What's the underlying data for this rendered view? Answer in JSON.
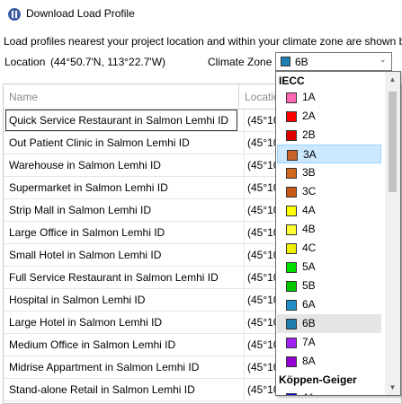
{
  "window": {
    "title": "Download Load Profile"
  },
  "description": "Load profiles nearest your project location and within your climate zone are shown b",
  "location": {
    "label": "Location",
    "value": "(44°50.7'N, 113°22.7'W)"
  },
  "climate_zone": {
    "label": "Climate Zone",
    "selected": "6B",
    "selected_color": "#1e7fb0"
  },
  "table": {
    "columns": [
      "Name",
      "Location",
      ""
    ],
    "rows": [
      {
        "name": "Quick Service Restaurant in Salmon Lemhi ID",
        "loc": "(45°10"
      },
      {
        "name": "Out Patient Clinic in Salmon Lemhi ID",
        "loc": "(45°10"
      },
      {
        "name": "Warehouse in Salmon Lemhi ID",
        "loc": "(45°10"
      },
      {
        "name": "Supermarket in Salmon Lemhi ID",
        "loc": "(45°10"
      },
      {
        "name": "Strip Mall in Salmon Lemhi ID",
        "loc": "(45°10"
      },
      {
        "name": "Large Office in Salmon Lemhi ID",
        "loc": "(45°10"
      },
      {
        "name": "Small Hotel in Salmon Lemhi ID",
        "loc": "(45°10"
      },
      {
        "name": "Full Service Restaurant in Salmon Lemhi ID",
        "loc": "(45°10"
      },
      {
        "name": "Hospital in Salmon Lemhi ID",
        "loc": "(45°10"
      },
      {
        "name": "Large Hotel in Salmon Lemhi ID",
        "loc": "(45°10"
      },
      {
        "name": "Medium Office in Salmon Lemhi ID",
        "loc": "(45°10"
      },
      {
        "name": "Midrise Appartment in Salmon Lemhi ID",
        "loc": "(45°10"
      },
      {
        "name": "Stand-alone Retail in Salmon Lemhi ID",
        "loc": "(45°10"
      }
    ]
  },
  "dropdown": {
    "group_iecc": "IECC",
    "group_koppen": "Köppen-Geiger",
    "items": [
      {
        "label": "1A",
        "color": "#ff69b4"
      },
      {
        "label": "2A",
        "color": "#ff0000"
      },
      {
        "label": "2B",
        "color": "#e00000"
      },
      {
        "label": "3A",
        "color": "#c86428"
      },
      {
        "label": "3B",
        "color": "#d2691e"
      },
      {
        "label": "3C",
        "color": "#c85a14"
      },
      {
        "label": "4A",
        "color": "#ffff00"
      },
      {
        "label": "4B",
        "color": "#ffff33"
      },
      {
        "label": "4C",
        "color": "#f0f000"
      },
      {
        "label": "5A",
        "color": "#00e000"
      },
      {
        "label": "5B",
        "color": "#00c800"
      },
      {
        "label": "6A",
        "color": "#1e8fc8"
      },
      {
        "label": "6B",
        "color": "#1e7fb0"
      },
      {
        "label": "7A",
        "color": "#a020f0"
      },
      {
        "label": "8A",
        "color": "#9400d3"
      }
    ],
    "koppen_items": [
      {
        "label": "Af",
        "color": "#0000ff"
      }
    ]
  }
}
